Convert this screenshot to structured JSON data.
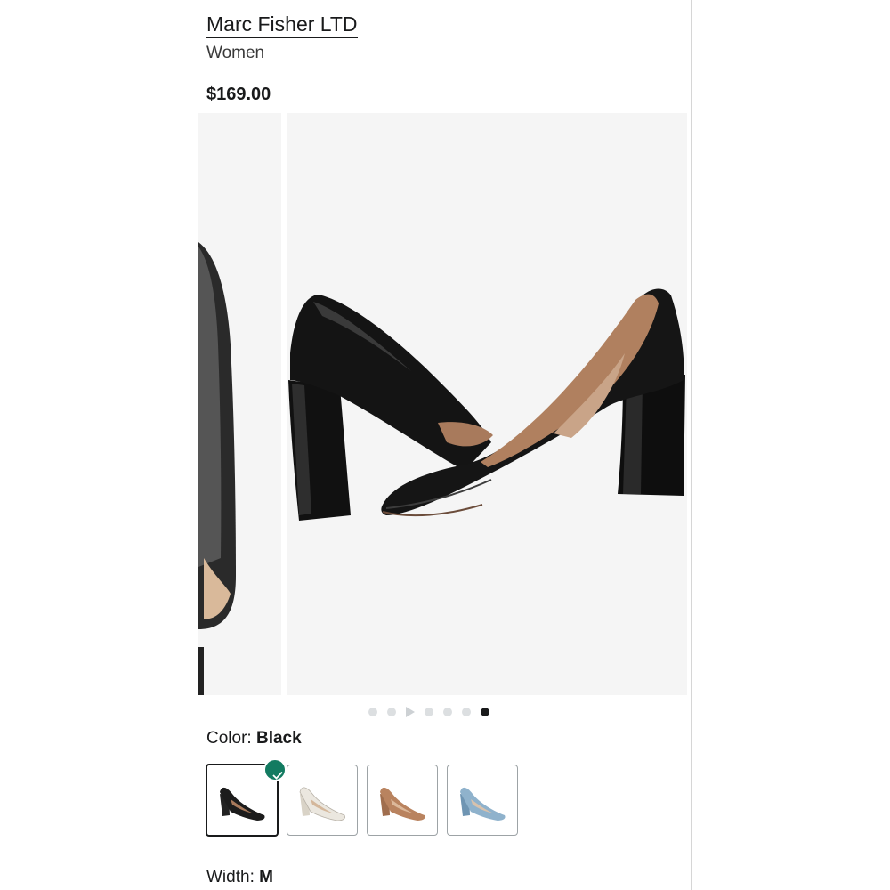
{
  "product": {
    "brand": "Marc Fisher LTD",
    "category": "Women",
    "price": "$169.00"
  },
  "gallery": {
    "dot_count": 7,
    "active_index": 6,
    "video_dot_index": 2
  },
  "color": {
    "label": "Color:",
    "selected": "Black",
    "swatches": [
      {
        "name": "Black",
        "hex": "#1c1c1c",
        "selected": true
      },
      {
        "name": "White",
        "hex": "#ebe7df",
        "selected": false
      },
      {
        "name": "Tan",
        "hex": "#b9835f",
        "selected": false
      },
      {
        "name": "Blue",
        "hex": "#8fb2cc",
        "selected": false
      }
    ],
    "check_icon": "check-icon",
    "check_color": "#137b61"
  },
  "width": {
    "label": "Width:",
    "selected": "M"
  }
}
